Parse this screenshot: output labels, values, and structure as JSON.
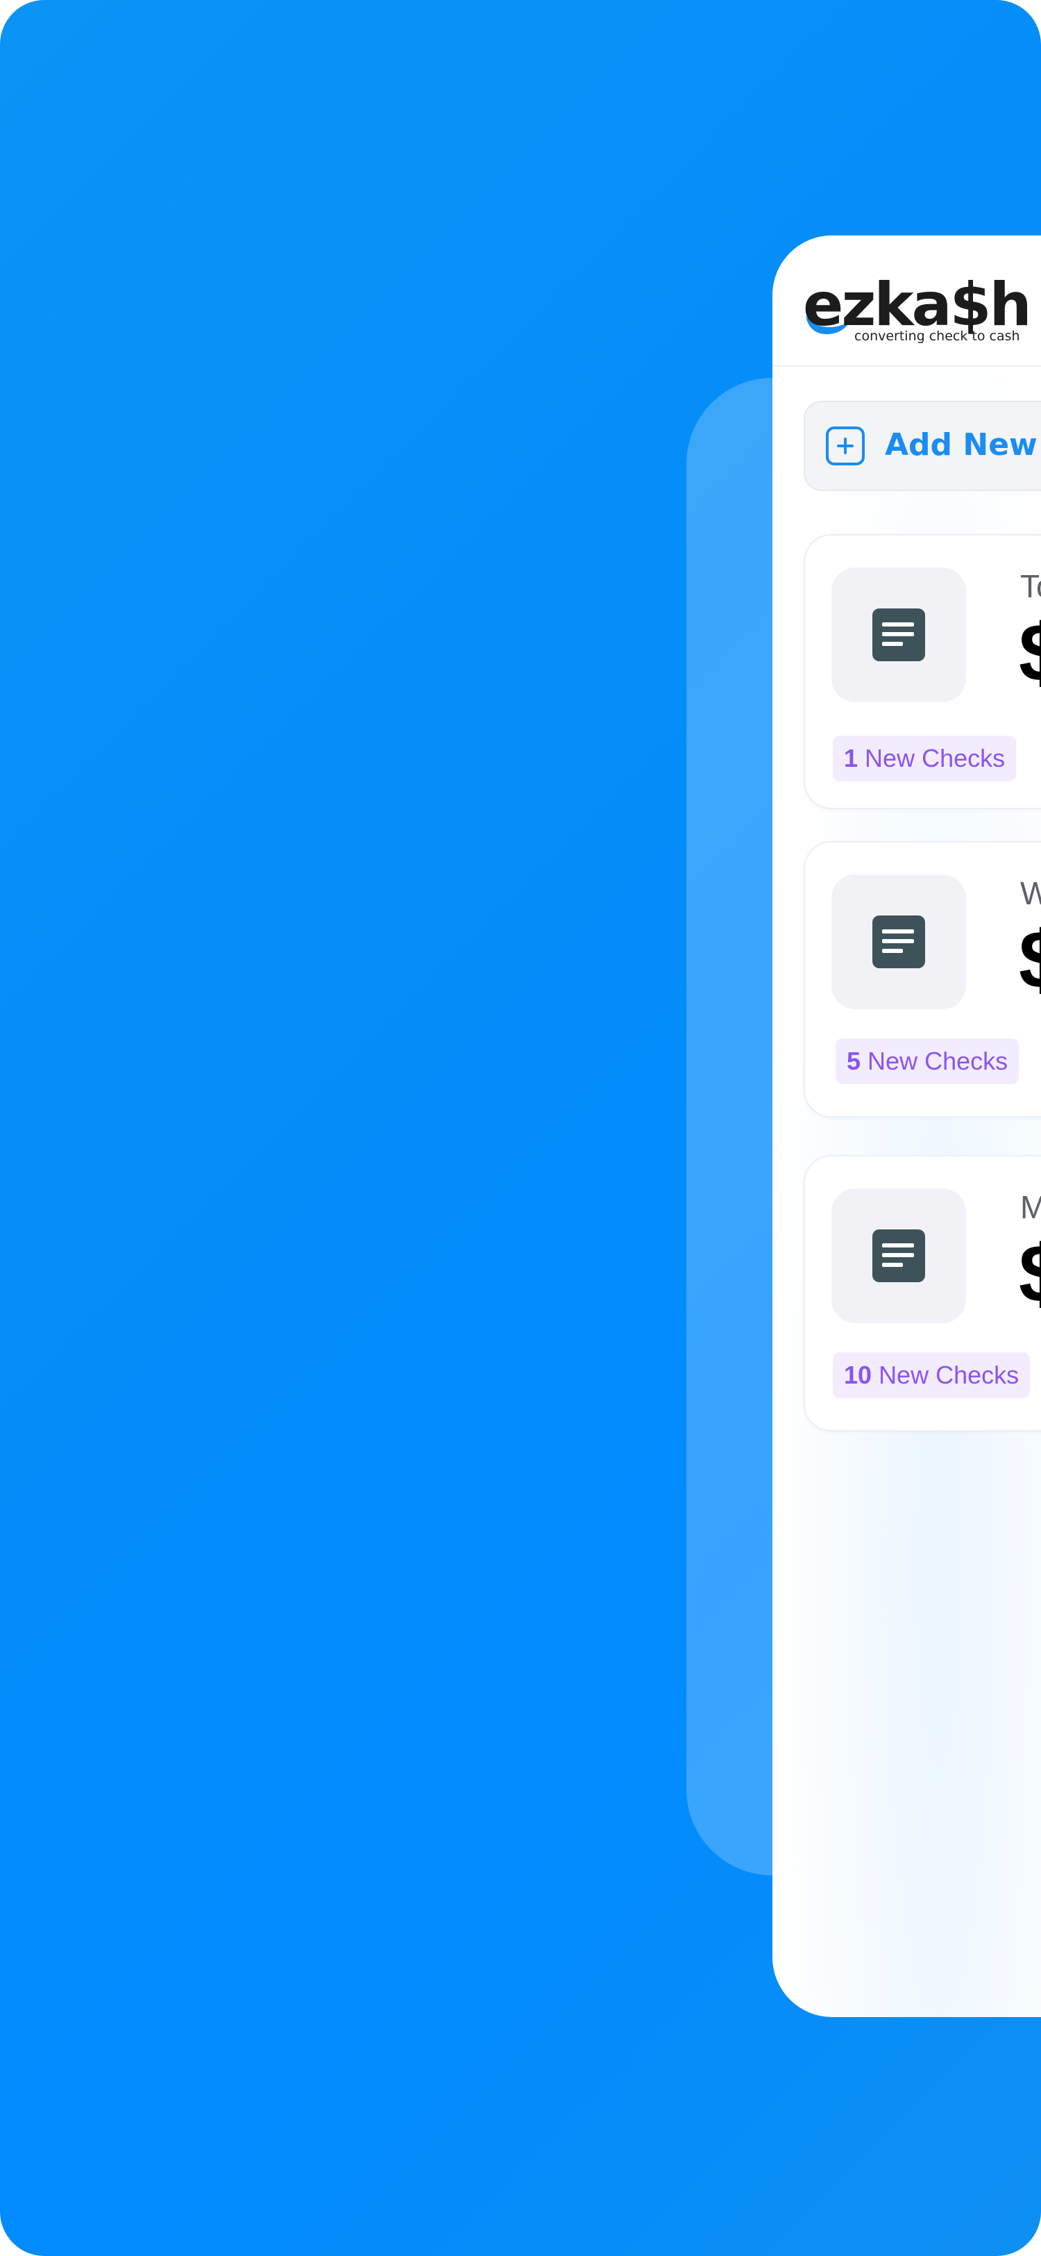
{
  "brand": {
    "name": "ezka$h",
    "tagline": "converting check to cash",
    "accent": "#1a8cf2",
    "background": "#058df8"
  },
  "actions": {
    "add_new_label": "Add New C"
  },
  "cards": [
    {
      "title": "To",
      "amount": "$",
      "badge_count": "1",
      "badge_text": "New Checks",
      "icon": "document-icon"
    },
    {
      "title": "W",
      "amount": "$",
      "badge_count": "5",
      "badge_text": "New Checks",
      "icon": "document-icon"
    },
    {
      "title": "M",
      "amount": "$",
      "badge_count": "10",
      "badge_text": "New Checks",
      "icon": "document-icon"
    }
  ]
}
